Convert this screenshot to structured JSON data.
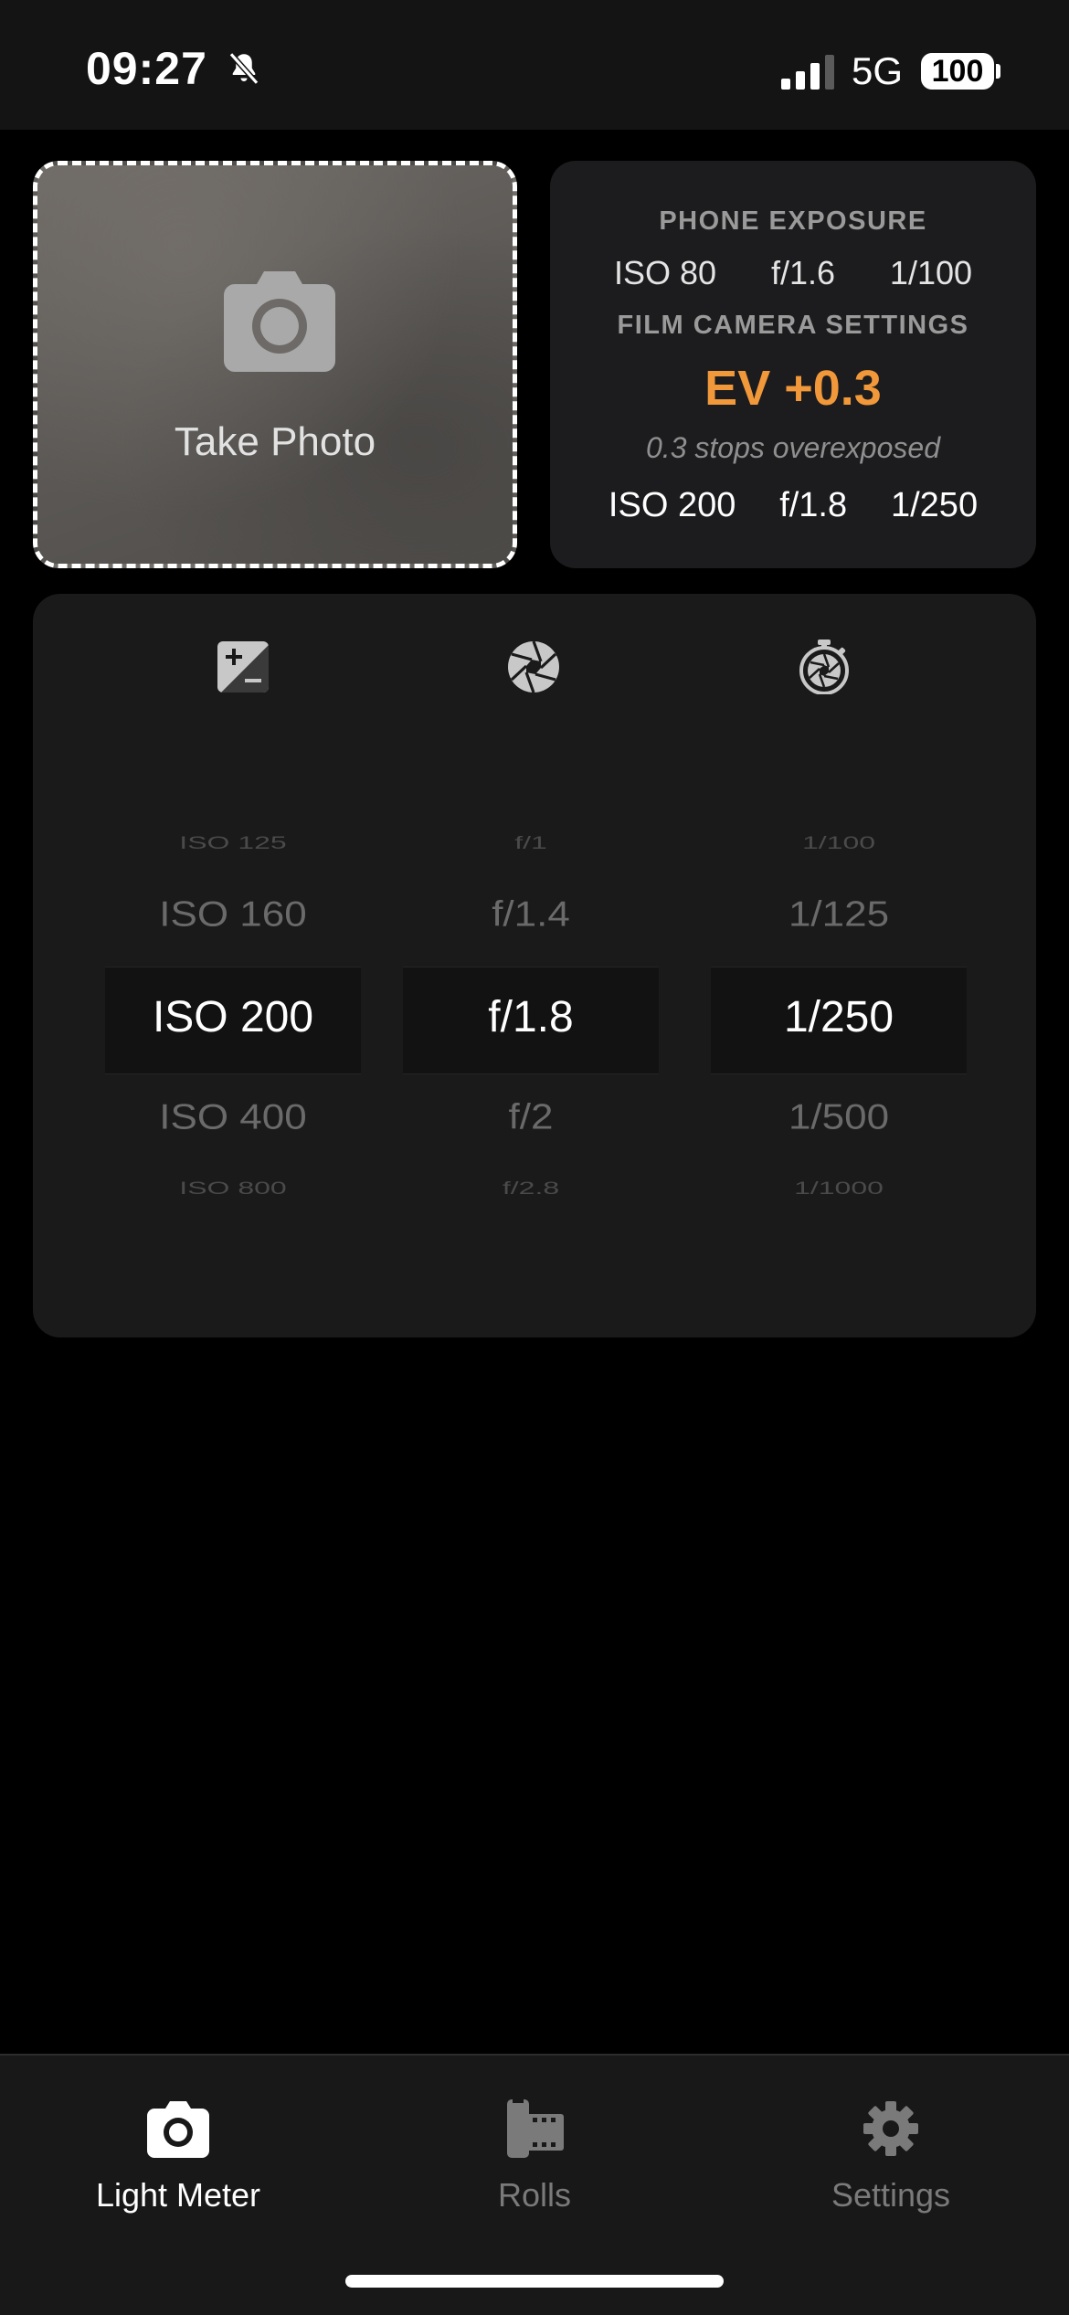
{
  "status_bar": {
    "time": "09:27",
    "network": "5G",
    "battery": "100"
  },
  "photo_tile": {
    "label": "Take Photo"
  },
  "exposure_card": {
    "phone_header": "PHONE EXPOSURE",
    "phone": {
      "iso": "ISO 80",
      "aperture": "f/1.6",
      "shutter": "1/100"
    },
    "film_header": "FILM CAMERA SETTINGS",
    "ev": "EV +0.3",
    "ev_note": "0.3 stops overexposed",
    "film": {
      "iso": "ISO 200",
      "aperture": "f/1.8",
      "shutter": "1/250"
    },
    "ev_color": "#f0983a"
  },
  "pickers": {
    "iso": {
      "icon": "exposure-compensation-icon",
      "values": [
        "ISO 125",
        "ISO 160",
        "ISO 200",
        "ISO 400",
        "ISO 800"
      ],
      "selected": "ISO 200"
    },
    "aperture": {
      "icon": "aperture-icon",
      "values": [
        "f/1",
        "f/1.4",
        "f/1.8",
        "f/2",
        "f/2.8"
      ],
      "selected": "f/1.8"
    },
    "shutter": {
      "icon": "timer-aperture-icon",
      "values": [
        "1/100",
        "1/125",
        "1/250",
        "1/500",
        "1/1000"
      ],
      "selected": "1/250"
    }
  },
  "tabbar": {
    "tabs": [
      {
        "label": "Light Meter",
        "icon": "camera-icon",
        "active": true
      },
      {
        "label": "Rolls",
        "icon": "film-roll-icon",
        "active": false
      },
      {
        "label": "Settings",
        "icon": "gear-icon",
        "active": false
      }
    ],
    "active_color": "#ffffff",
    "inactive_color": "#7a7a7a"
  }
}
